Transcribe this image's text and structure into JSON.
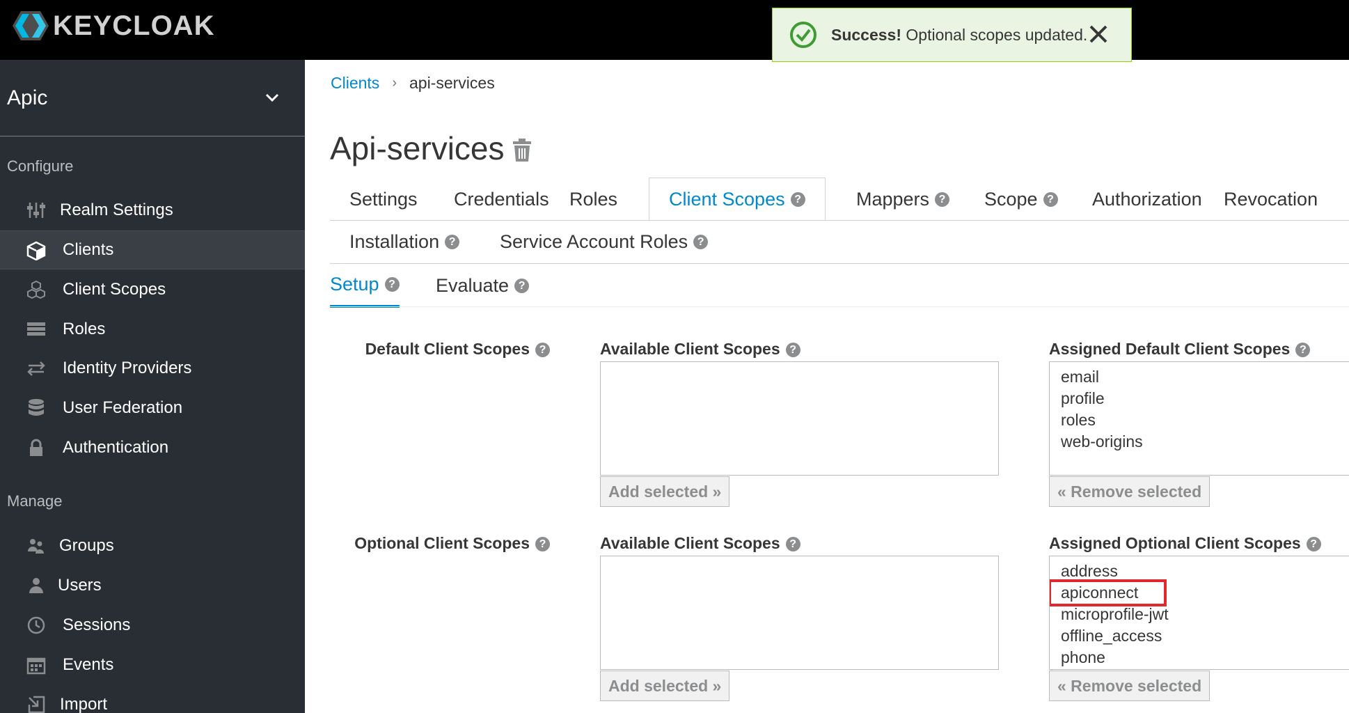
{
  "brand": {
    "name": "KEYCLOAK"
  },
  "toast": {
    "strong": "Success!",
    "message": " Optional scopes updated."
  },
  "sidebar": {
    "realm": "Apic",
    "configure_label": "Configure",
    "manage_label": "Manage",
    "configure_items": [
      {
        "label": "Realm Settings",
        "icon": "sliders-icon"
      },
      {
        "label": "Clients",
        "icon": "cube-icon",
        "active": true
      },
      {
        "label": "Client Scopes",
        "icon": "cubes-icon"
      },
      {
        "label": "Roles",
        "icon": "list-icon"
      },
      {
        "label": "Identity Providers",
        "icon": "exchange-icon"
      },
      {
        "label": "User Federation",
        "icon": "database-icon"
      },
      {
        "label": "Authentication",
        "icon": "lock-icon"
      }
    ],
    "manage_items": [
      {
        "label": "Groups",
        "icon": "users-icon"
      },
      {
        "label": "Users",
        "icon": "user-icon"
      },
      {
        "label": "Sessions",
        "icon": "clock-icon"
      },
      {
        "label": "Events",
        "icon": "calendar-icon"
      },
      {
        "label": "Import",
        "icon": "import-icon"
      }
    ]
  },
  "breadcrumb": {
    "parent": "Clients",
    "separator": "›",
    "current": "api-services"
  },
  "page_title": "Api-services",
  "tabs": {
    "settings": "Settings",
    "credentials": "Credentials",
    "roles": "Roles",
    "client_scopes": "Client Scopes",
    "mappers": "Mappers",
    "scope": "Scope",
    "authorization": "Authorization",
    "revocation": "Revocation",
    "installation": "Installation",
    "service_account_roles": "Service Account Roles"
  },
  "subtabs": {
    "setup": "Setup",
    "evaluate": "Evaluate"
  },
  "default_scopes": {
    "row_label": "Default Client Scopes",
    "available_label": "Available Client Scopes",
    "assigned_label": "Assigned Default Client Scopes",
    "available": [],
    "assigned": [
      "email",
      "profile",
      "roles",
      "web-origins"
    ],
    "add_button": "Add selected »",
    "remove_button": "« Remove selected"
  },
  "optional_scopes": {
    "row_label": "Optional Client Scopes",
    "available_label": "Available Client Scopes",
    "assigned_label": "Assigned Optional Client Scopes",
    "available": [],
    "assigned": [
      "address",
      "apiconnect",
      "microprofile-jwt",
      "offline_access",
      "phone"
    ],
    "highlighted": "apiconnect",
    "add_button": "Add selected »",
    "remove_button": "« Remove selected"
  },
  "colors": {
    "accent": "#0088ce",
    "sidebar": "#292e34",
    "highlight": "#e0282e",
    "success": "#3f9c35"
  }
}
